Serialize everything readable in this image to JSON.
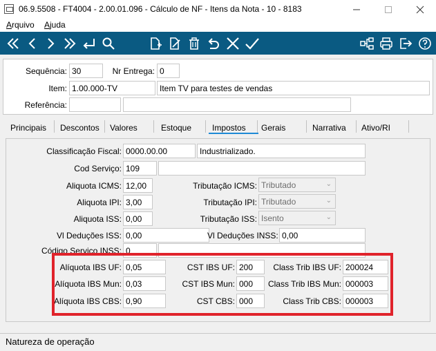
{
  "window": {
    "title": "06.9.5508 - FT4004 - 2.00.01.096 - Cálculo de NF - Itens da Nota - 10 - 8183"
  },
  "menu": [
    {
      "label": "Arquivo",
      "key": "A",
      "rest": "rquivo"
    },
    {
      "label": "Ajuda",
      "key": "A",
      "rest": "juda"
    }
  ],
  "toolbar": {
    "left": [
      "first-icon",
      "prev-icon",
      "next-icon",
      "last-icon",
      "enter-icon",
      "search-icon"
    ],
    "middle": [
      "new-document-icon",
      "edit-document-icon",
      "delete-icon",
      "undo-icon",
      "cancel-icon",
      "confirm-icon"
    ],
    "right": [
      "tree-icon",
      "print-icon",
      "exit-icon",
      "help-icon"
    ]
  },
  "header": {
    "sequencia_label": "Sequência:",
    "sequencia_value": "30",
    "nr_entrega_label": "Nr Entrega:",
    "nr_entrega_value": "0",
    "item_label": "Item:",
    "item_code": "1.00.000-TV",
    "item_desc": "Item TV para testes de vendas",
    "referencia_label": "Referência:",
    "referencia_code": "",
    "referencia_desc": ""
  },
  "tabs": [
    {
      "label": "Principais"
    },
    {
      "label": "Descontos"
    },
    {
      "label": "Valores"
    },
    {
      "label": "Estoque"
    },
    {
      "label": "Impostos"
    },
    {
      "label": "Gerais"
    },
    {
      "label": "Narrativa"
    },
    {
      "label": "Ativo/RI"
    }
  ],
  "impostos": {
    "classificacao_label": "Classificação Fiscal:",
    "classificacao_value": "0000.00.00",
    "classificacao_desc": "Industrializado.",
    "cod_servico_label": "Cod Serviço:",
    "cod_servico_value": "109",
    "cod_servico_desc": "",
    "aliq_icms_label": "Aliquota ICMS:",
    "aliq_icms_value": "12,00",
    "trib_icms_label": "Tributação ICMS:",
    "trib_icms_value": "Tributado",
    "aliq_ipi_label": "Aliquota IPI:",
    "aliq_ipi_value": "3,00",
    "trib_ipi_label": "Tributação IPI:",
    "trib_ipi_value": "Tributado",
    "aliq_iss_label": "Aliquota ISS:",
    "aliq_iss_value": "0,00",
    "trib_iss_label": "Tributação ISS:",
    "trib_iss_value": "Isento",
    "ded_iss_label": "Vl Deduções ISS:",
    "ded_iss_value": "0,00",
    "ded_inss_label": "Vl Deduções INSS:",
    "ded_inss_value": "0,00",
    "cod_serv_inss_label": "Código Serviço INSS:",
    "cod_serv_inss_value": "0",
    "cod_serv_inss_desc": "",
    "aliq_ibs_uf_label": "Alíquota IBS UF:",
    "aliq_ibs_uf_value": "0,05",
    "aliq_ibs_mun_label": "Alíquota IBS Mun:",
    "aliq_ibs_mun_value": "0,03",
    "aliq_ibs_cbs_label": "Alíquota IBS CBS:",
    "aliq_ibs_cbs_value": "0,90",
    "cst_ibs_uf_label": "CST IBS UF:",
    "cst_ibs_uf_value": "200",
    "cst_ibs_mun_label": "CST IBS Mun:",
    "cst_ibs_mun_value": "000",
    "cst_cbs_label": "CST CBS:",
    "cst_cbs_value": "000",
    "class_trib_uf_label": "Class Trib IBS UF:",
    "class_trib_uf_value": "200024",
    "class_trib_mun_label": "Class Trib IBS Mun:",
    "class_trib_mun_value": "000003",
    "class_trib_cbs_label": "Class Trib CBS:",
    "class_trib_cbs_value": "000003"
  },
  "status": {
    "text": "Natureza de operação"
  },
  "colors": {
    "toolbar": "#0a5a82",
    "highlight": "#e0232b",
    "tab_active": "#1e8ad6"
  }
}
